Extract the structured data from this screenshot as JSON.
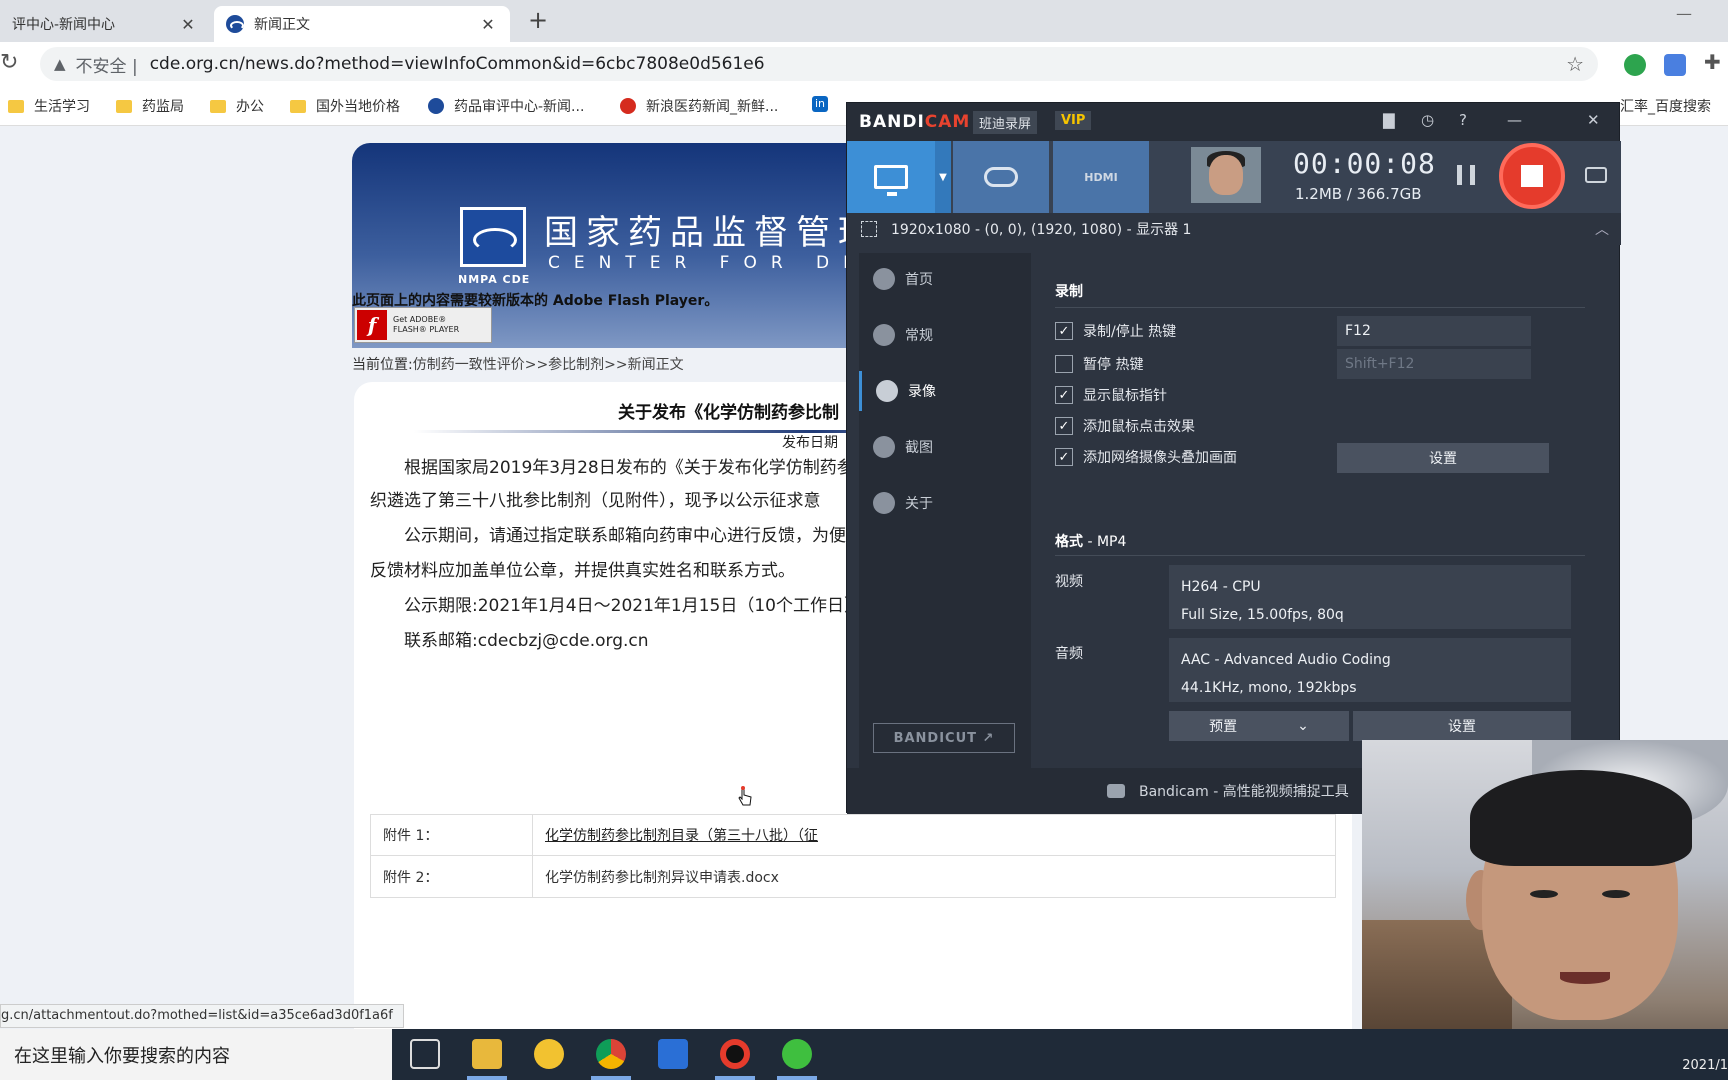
{
  "browser": {
    "tabs": [
      {
        "title": "评中心-新闻中心",
        "close": "✕"
      },
      {
        "title": "新闻正文",
        "close": "✕"
      }
    ],
    "new_tab": "+",
    "window_min": "—",
    "reload": "↻",
    "security_icon": "▲",
    "insecure_label": "不安全 |",
    "url": "cde.org.cn/news.do?method=viewInfoCommon&id=6cbc7808e0d561e6",
    "star": "☆",
    "extensions_icon": "✚",
    "bookmarks": [
      {
        "label": "生活学习",
        "icon": "folder"
      },
      {
        "label": "药监局",
        "icon": "folder"
      },
      {
        "label": "办公",
        "icon": "folder"
      },
      {
        "label": "国外当地价格",
        "icon": "folder"
      },
      {
        "label": "药品审评中心-新闻...",
        "icon": "cde"
      },
      {
        "label": "新浪医药新闻_新鲜...",
        "icon": "weibo"
      },
      {
        "label": "in",
        "icon": "linkedin"
      },
      {
        "label": "汇率_百度搜索",
        "icon": "baidu"
      }
    ]
  },
  "page": {
    "banner_cn": "国家药品监督管理",
    "banner_en": "CENTER FOR DRUG",
    "banner_logo_text": "NMPA CDE",
    "flash_message": "此页面上的内容需要较新版本的 Adobe Flash Player。",
    "flash_button": {
      "icon": "f",
      "line1": "Get ADOBE®",
      "line2": "FLASH® PLAYER"
    },
    "breadcrumb": {
      "prefix": "当前位置:",
      "path": "仿制药一致性评价>>参比制剂>>新闻正文"
    },
    "headline": "关于发布《化学仿制药参比制",
    "pubdate": "发布日期",
    "paragraphs": [
      "根据国家局2019年3月28日发布的《关于发布化学仿制药参",
      "织遴选了第三十八批参比制剂（见附件），现予以公示征求意",
      "公示期间，请通过指定联系邮箱向药审中心进行反馈，为便",
      "反馈材料应加盖单位公章，并提供真实姓名和联系方式。",
      "公示期限:2021年1月4日～2021年1月15日（10个工作日）",
      "联系邮箱:cdecbzj@cde.org.cn"
    ],
    "attachments": [
      {
        "label": "附件 1：",
        "value": "化学仿制药参比制剂目录（第三十八批）（征"
      },
      {
        "label": "附件 2：",
        "value": "化学仿制药参比制剂异议申请表.docx"
      }
    ],
    "status_url": "g.cn/attachmentout.do?mothed=list&id=a35ce6ad3d0f1a6f"
  },
  "bandicam": {
    "logo_a": "BANDI",
    "logo_b": "CAM",
    "brand_cn": "班迪录屏",
    "vip": "VIP",
    "title_icons": [
      "folder-icon",
      "clock-icon",
      "help-icon",
      "minimize-icon",
      "close-icon"
    ],
    "title_glyphs": {
      "folder": "▇",
      "clock": "◷",
      "help": "?",
      "min": "—",
      "close": "✕"
    },
    "mode_drop": "▼",
    "mode_hdmi": "HDMI",
    "timer": "00:00:08",
    "size": "1.2MB / 366.7GB",
    "region": "1920x1080 - (0, 0), (1920, 1080) - 显示器 1",
    "region_caret": "︿",
    "nav": [
      {
        "label": "首页",
        "icon": "home-icon"
      },
      {
        "label": "常规",
        "icon": "gear-icon"
      },
      {
        "label": "录像",
        "icon": "video-gear-icon"
      },
      {
        "label": "截图",
        "icon": "screenshot-icon"
      },
      {
        "label": "关于",
        "icon": "info-icon"
      }
    ],
    "bandicut": "BANDICUT ↗",
    "record_section": "录制",
    "checks": [
      {
        "label": "录制/停止 热键",
        "checked": true
      },
      {
        "label": "暂停 热键",
        "checked": false
      },
      {
        "label": "显示鼠标指针",
        "checked": true
      },
      {
        "label": "添加鼠标点击效果",
        "checked": true
      },
      {
        "label": "添加网络摄像头叠加画面",
        "checked": true
      }
    ],
    "check_mark": "✓",
    "hotkey_record": "F12",
    "hotkey_pause": "Shift+F12",
    "webcam_settings": "设置",
    "format_section": "格式",
    "format_value": " - MP4",
    "video_label": "视频",
    "video_line1": "H264 - CPU",
    "video_line2": "Full Size, 15.00fps, 80q",
    "audio_label": "音频",
    "audio_line1": "AAC - Advanced Audio Coding",
    "audio_line2": "44.1KHz, mono, 192kbps",
    "preset_button": "预置",
    "preset_caret": "⌄",
    "format_settings": "设置",
    "footer": "Bandicam - 高性能视频捕捉工具"
  },
  "taskbar": {
    "search_placeholder": "在这里输入你要搜索的内容",
    "clock_fragment": "2021/1",
    "apps": [
      "task-view-icon",
      "file-explorer-icon",
      "favorites-icon",
      "chrome-icon",
      "wps-icon",
      "bandicam-icon",
      "wechat-icon"
    ]
  },
  "colors": {
    "accent": "#3d8fd6",
    "record_red": "#e53b2c",
    "banner_blue": "#14357a"
  }
}
